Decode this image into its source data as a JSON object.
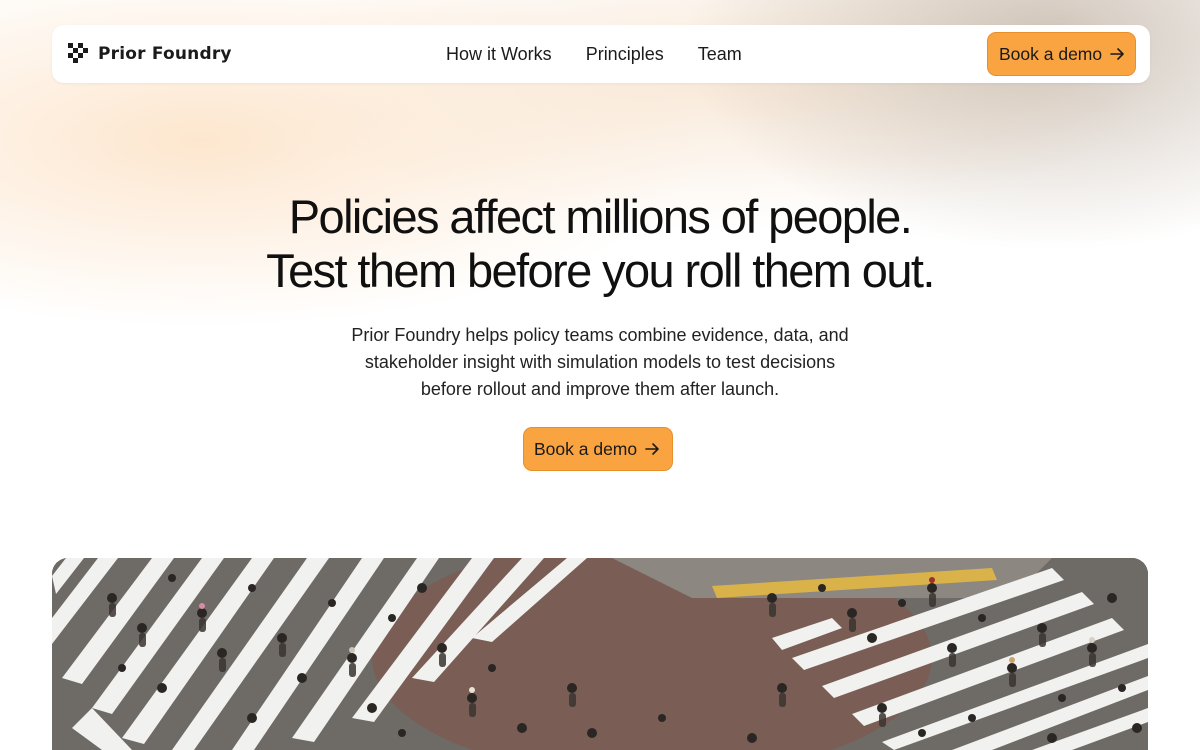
{
  "header": {
    "brand_name": "Prior Foundry",
    "brand_icon": "pixel-logo-icon",
    "nav_links": [
      {
        "label": "How it Works"
      },
      {
        "label": "Principles"
      },
      {
        "label": "Team"
      }
    ],
    "cta_label": "Book a demo"
  },
  "hero": {
    "title_line1": "Policies affect millions of people.",
    "title_line2": "Test them before you roll them out.",
    "subtitle": "Prior Foundry helps policy teams combine evidence, data, and stakeholder insight with simulation models to test decisions before rollout and improve them after launch.",
    "cta_label": "Book a demo",
    "cta_icon": "arrow-right-icon",
    "image": "crowd-crosswalk-photo"
  },
  "colors": {
    "accent": "#f9a441",
    "accent_border": "#e88f2a",
    "text": "#141414"
  }
}
